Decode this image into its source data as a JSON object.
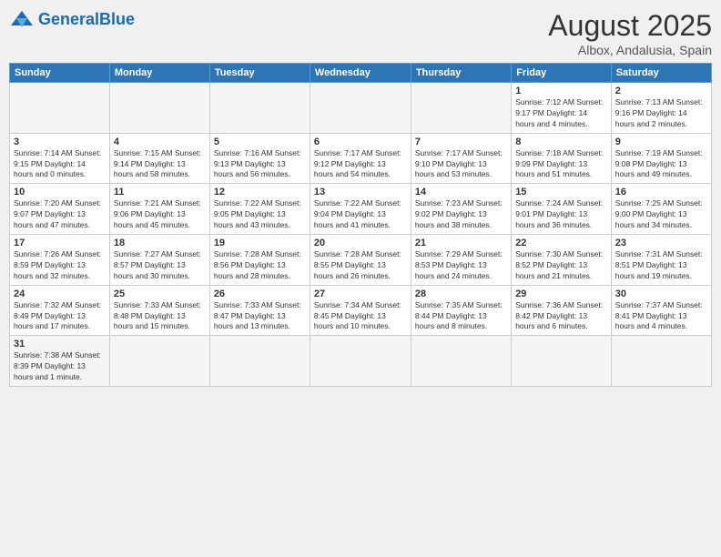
{
  "header": {
    "logo_general": "General",
    "logo_blue": "Blue",
    "month_title": "August 2025",
    "location": "Albox, Andalusia, Spain"
  },
  "days_of_week": [
    "Sunday",
    "Monday",
    "Tuesday",
    "Wednesday",
    "Thursday",
    "Friday",
    "Saturday"
  ],
  "weeks": [
    [
      {
        "day": "",
        "info": ""
      },
      {
        "day": "",
        "info": ""
      },
      {
        "day": "",
        "info": ""
      },
      {
        "day": "",
        "info": ""
      },
      {
        "day": "",
        "info": ""
      },
      {
        "day": "1",
        "info": "Sunrise: 7:12 AM\nSunset: 9:17 PM\nDaylight: 14 hours and 4 minutes."
      },
      {
        "day": "2",
        "info": "Sunrise: 7:13 AM\nSunset: 9:16 PM\nDaylight: 14 hours and 2 minutes."
      }
    ],
    [
      {
        "day": "3",
        "info": "Sunrise: 7:14 AM\nSunset: 9:15 PM\nDaylight: 14 hours and 0 minutes."
      },
      {
        "day": "4",
        "info": "Sunrise: 7:15 AM\nSunset: 9:14 PM\nDaylight: 13 hours and 58 minutes."
      },
      {
        "day": "5",
        "info": "Sunrise: 7:16 AM\nSunset: 9:13 PM\nDaylight: 13 hours and 56 minutes."
      },
      {
        "day": "6",
        "info": "Sunrise: 7:17 AM\nSunset: 9:12 PM\nDaylight: 13 hours and 54 minutes."
      },
      {
        "day": "7",
        "info": "Sunrise: 7:17 AM\nSunset: 9:10 PM\nDaylight: 13 hours and 53 minutes."
      },
      {
        "day": "8",
        "info": "Sunrise: 7:18 AM\nSunset: 9:09 PM\nDaylight: 13 hours and 51 minutes."
      },
      {
        "day": "9",
        "info": "Sunrise: 7:19 AM\nSunset: 9:08 PM\nDaylight: 13 hours and 49 minutes."
      }
    ],
    [
      {
        "day": "10",
        "info": "Sunrise: 7:20 AM\nSunset: 9:07 PM\nDaylight: 13 hours and 47 minutes."
      },
      {
        "day": "11",
        "info": "Sunrise: 7:21 AM\nSunset: 9:06 PM\nDaylight: 13 hours and 45 minutes."
      },
      {
        "day": "12",
        "info": "Sunrise: 7:22 AM\nSunset: 9:05 PM\nDaylight: 13 hours and 43 minutes."
      },
      {
        "day": "13",
        "info": "Sunrise: 7:22 AM\nSunset: 9:04 PM\nDaylight: 13 hours and 41 minutes."
      },
      {
        "day": "14",
        "info": "Sunrise: 7:23 AM\nSunset: 9:02 PM\nDaylight: 13 hours and 38 minutes."
      },
      {
        "day": "15",
        "info": "Sunrise: 7:24 AM\nSunset: 9:01 PM\nDaylight: 13 hours and 36 minutes."
      },
      {
        "day": "16",
        "info": "Sunrise: 7:25 AM\nSunset: 9:00 PM\nDaylight: 13 hours and 34 minutes."
      }
    ],
    [
      {
        "day": "17",
        "info": "Sunrise: 7:26 AM\nSunset: 8:59 PM\nDaylight: 13 hours and 32 minutes."
      },
      {
        "day": "18",
        "info": "Sunrise: 7:27 AM\nSunset: 8:57 PM\nDaylight: 13 hours and 30 minutes."
      },
      {
        "day": "19",
        "info": "Sunrise: 7:28 AM\nSunset: 8:56 PM\nDaylight: 13 hours and 28 minutes."
      },
      {
        "day": "20",
        "info": "Sunrise: 7:28 AM\nSunset: 8:55 PM\nDaylight: 13 hours and 26 minutes."
      },
      {
        "day": "21",
        "info": "Sunrise: 7:29 AM\nSunset: 8:53 PM\nDaylight: 13 hours and 24 minutes."
      },
      {
        "day": "22",
        "info": "Sunrise: 7:30 AM\nSunset: 8:52 PM\nDaylight: 13 hours and 21 minutes."
      },
      {
        "day": "23",
        "info": "Sunrise: 7:31 AM\nSunset: 8:51 PM\nDaylight: 13 hours and 19 minutes."
      }
    ],
    [
      {
        "day": "24",
        "info": "Sunrise: 7:32 AM\nSunset: 8:49 PM\nDaylight: 13 hours and 17 minutes."
      },
      {
        "day": "25",
        "info": "Sunrise: 7:33 AM\nSunset: 8:48 PM\nDaylight: 13 hours and 15 minutes."
      },
      {
        "day": "26",
        "info": "Sunrise: 7:33 AM\nSunset: 8:47 PM\nDaylight: 13 hours and 13 minutes."
      },
      {
        "day": "27",
        "info": "Sunrise: 7:34 AM\nSunset: 8:45 PM\nDaylight: 13 hours and 10 minutes."
      },
      {
        "day": "28",
        "info": "Sunrise: 7:35 AM\nSunset: 8:44 PM\nDaylight: 13 hours and 8 minutes."
      },
      {
        "day": "29",
        "info": "Sunrise: 7:36 AM\nSunset: 8:42 PM\nDaylight: 13 hours and 6 minutes."
      },
      {
        "day": "30",
        "info": "Sunrise: 7:37 AM\nSunset: 8:41 PM\nDaylight: 13 hours and 4 minutes."
      }
    ],
    [
      {
        "day": "31",
        "info": "Sunrise: 7:38 AM\nSunset: 8:39 PM\nDaylight: 13 hours and 1 minute."
      },
      {
        "day": "",
        "info": ""
      },
      {
        "day": "",
        "info": ""
      },
      {
        "day": "",
        "info": ""
      },
      {
        "day": "",
        "info": ""
      },
      {
        "day": "",
        "info": ""
      },
      {
        "day": "",
        "info": ""
      }
    ]
  ]
}
